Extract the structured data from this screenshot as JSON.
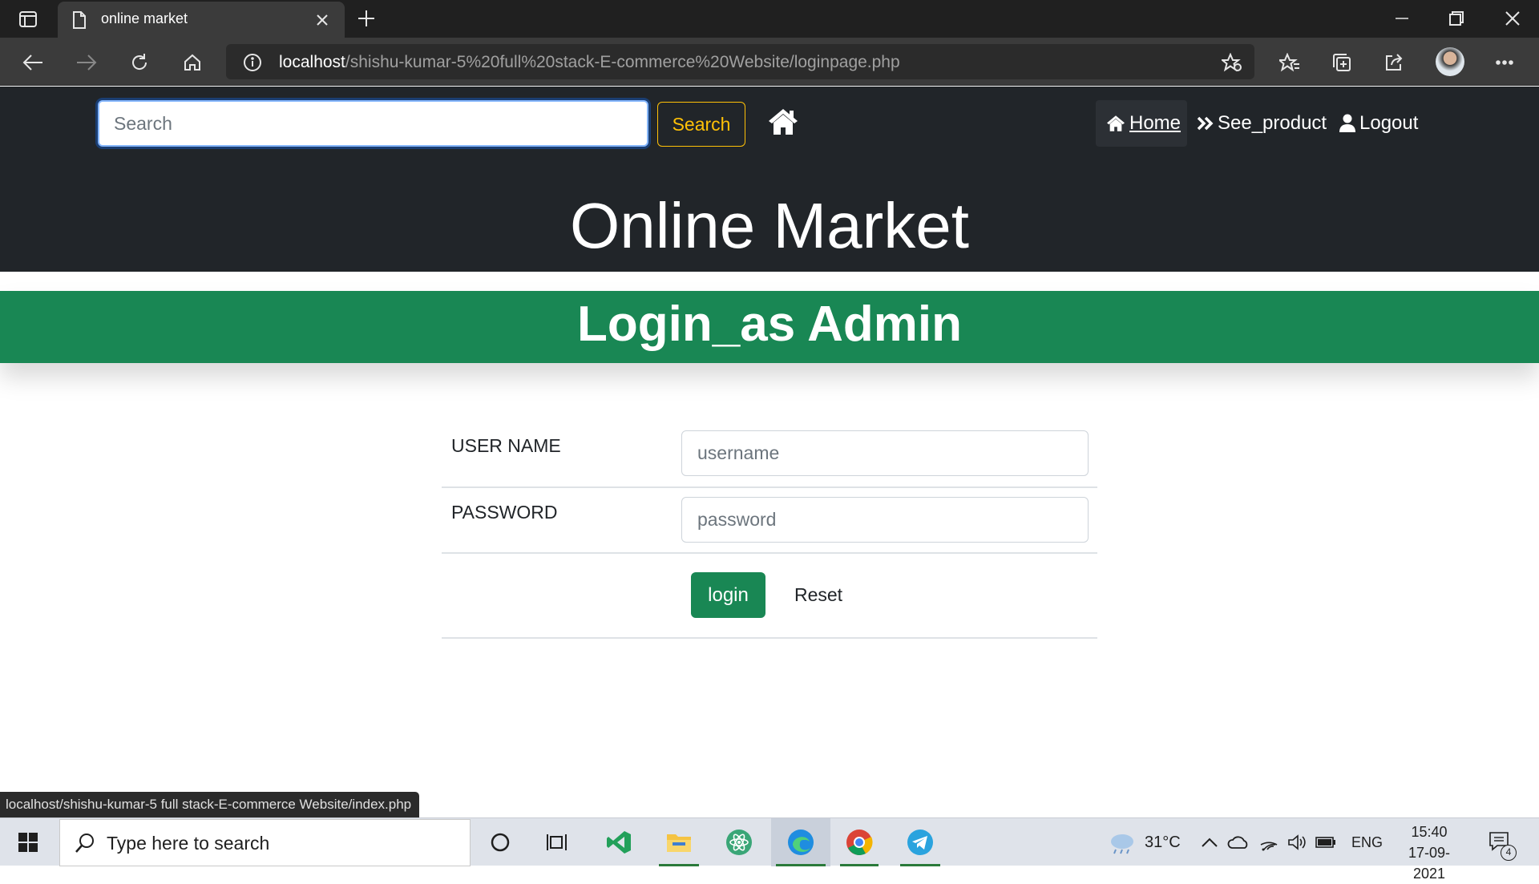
{
  "browser": {
    "tab_title": "online market",
    "url_host": "localhost",
    "url_path": "/shishu-kumar-5%20full%20stack-E-commerce%20Website/loginpage.php",
    "status_url": "localhost/shishu-kumar-5 full stack-E-commerce Website/index.php"
  },
  "header": {
    "search_placeholder": "Search",
    "search_button": "Search",
    "nav": {
      "home": "Home",
      "see_product": "See_product",
      "logout": "Logout"
    },
    "site_title": "Online Market"
  },
  "login": {
    "title": "Login_as Admin",
    "username_label": "USER NAME",
    "username_placeholder": "username",
    "password_label": "PASSWORD",
    "password_placeholder": "password",
    "login_button": "login",
    "reset_button": "Reset"
  },
  "taskbar": {
    "search_placeholder": "Type here to search",
    "weather": "31°C",
    "language": "ENG",
    "time": "15:40",
    "date": "17-09-2021",
    "notification_count": "4"
  },
  "colors": {
    "header_bg": "#212529",
    "banner_green": "#198754",
    "search_outline": "#ffc107"
  }
}
